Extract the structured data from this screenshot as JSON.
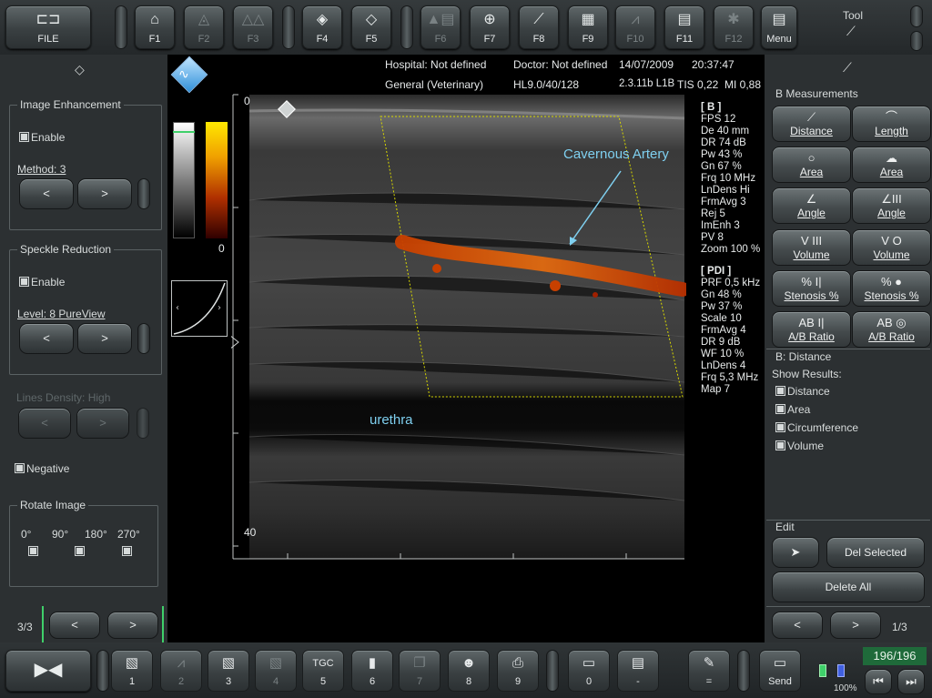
{
  "topbar": {
    "file": "FILE",
    "fkeys": [
      "F1",
      "F2",
      "F3",
      "F4",
      "F5",
      "F6",
      "F7",
      "F8",
      "F9",
      "F10",
      "F11",
      "F12"
    ],
    "menu": "Menu",
    "tool": "Tool"
  },
  "left": {
    "enhancement": {
      "title": "Image Enhancement",
      "enable": "Enable",
      "method": "Method: 3"
    },
    "speckle": {
      "title": "Speckle Reduction",
      "enable": "Enable",
      "level": "Level: 8 PureView"
    },
    "lines_density": "Lines Density: High",
    "negative": "Negative",
    "rotate": {
      "title": "Rotate Image",
      "angles": [
        "0°",
        "90°",
        "180°",
        "270°"
      ]
    },
    "page": "3/3",
    "prev": "<",
    "next": ">"
  },
  "header": {
    "hospital": "Hospital: Not defined",
    "doctor": "Doctor: Not defined",
    "date": "14/07/2009",
    "time": "20:37:47",
    "preset": "General (Veterinary)",
    "probe": "HL9.0/40/128",
    "freq_line": "2.3.11b L1B",
    "tis": "TIS 0,22",
    "mi": "MI 0,88"
  },
  "image": {
    "depth_top": "0",
    "depth_bottom": "40",
    "colorbar_zero": "0",
    "annotation_artery": "Cavernous Artery",
    "annotation_urethra": "urethra"
  },
  "params_b": {
    "title": "[ B ]",
    "lines": [
      "FPS  12",
      "De  40 mm",
      "DR  74 dB",
      "Pw  43 %",
      "Gn  67 %",
      "Frq  10 MHz",
      "LnDens  Hi",
      "FrmAvg  3",
      "Rej  5",
      "ImEnh  3",
      "PV  8",
      "Zoom  100 %"
    ]
  },
  "params_pdi": {
    "title": "[ PDI ]",
    "lines": [
      "PRF  0,5 kHz",
      "Gn  48 %",
      "Pw  37 %",
      "Scale  10",
      "FrmAvg  4",
      "DR  9 dB",
      "WF  10 %",
      "LnDens  4",
      "Frq  5,3 MHz",
      "Map  7"
    ]
  },
  "right": {
    "measurements_title": "B Measurements",
    "buttons": [
      {
        "icon": "⟋",
        "label": "Distance"
      },
      {
        "icon": "⌒",
        "label": "Length"
      },
      {
        "icon": "○",
        "label": "Area"
      },
      {
        "icon": "☁",
        "label": "Area"
      },
      {
        "icon": "∠",
        "label": "Angle"
      },
      {
        "icon": "∠III",
        "label": "Angle"
      },
      {
        "icon": "V III",
        "label": "Volume"
      },
      {
        "icon": "V O",
        "label": "Volume"
      },
      {
        "icon": "% I|",
        "label": "Stenosis %"
      },
      {
        "icon": "% ●",
        "label": "Stenosis %"
      },
      {
        "icon": "AB I|",
        "label": "A/B Ratio"
      },
      {
        "icon": "AB ◎",
        "label": "A/B Ratio"
      }
    ],
    "distance_title": "B: Distance",
    "show_results": "Show Results:",
    "results": [
      "Distance",
      "Area",
      "Circumference",
      "Volume"
    ],
    "edit_title": "Edit",
    "del_selected": "Del Selected",
    "delete_all": "Delete All",
    "page": "1/3",
    "prev": "<",
    "next": ">"
  },
  "bottombar": {
    "keys": [
      "1",
      "2",
      "3",
      "4",
      "5",
      "6",
      "7",
      "8",
      "9",
      "0",
      "-",
      "=",
      "Send"
    ],
    "tgc": "TGC",
    "frames": "196/196",
    "battery": "100%"
  }
}
